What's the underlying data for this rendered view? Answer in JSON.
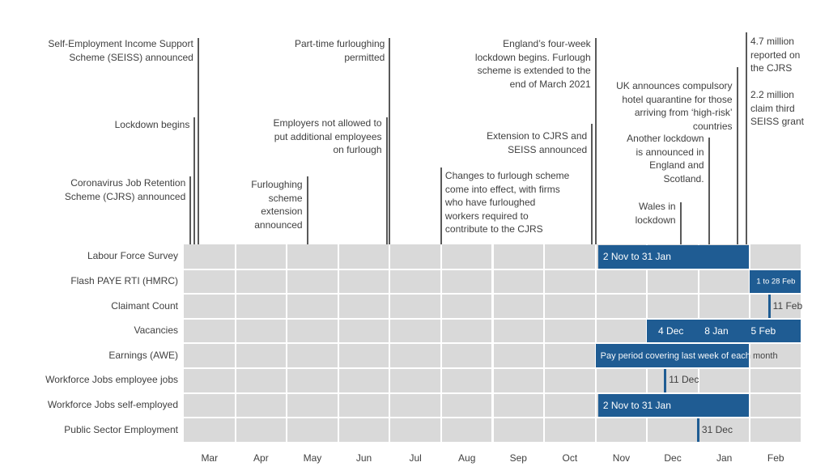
{
  "chart_data": {
    "type": "timeline",
    "title": "",
    "months": [
      "Mar",
      "Apr",
      "May",
      "Jun",
      "Jul",
      "Aug",
      "Sep",
      "Oct",
      "Nov",
      "Dec",
      "Jan",
      "Feb"
    ],
    "rows": [
      "Labour Force Survey",
      "Flash PAYE RTI (HMRC)",
      "Claimant Count",
      "Vacancies",
      "Earnings (AWE)",
      "Workforce Jobs employee jobs",
      "Workforce Jobs self-employed",
      "Public Sector Employment"
    ],
    "bars": [
      {
        "row": 0,
        "start": 8.05,
        "end": 11.0,
        "label": "2 Nov to 31 Jan"
      },
      {
        "row": 1,
        "start": 11.0,
        "end": 12.0,
        "label": "1 to 28 Feb",
        "small": true
      },
      {
        "row": 3,
        "start": 9.0,
        "end": 12.0,
        "labels": [
          {
            "text": "4 Dec",
            "at": 9.5
          },
          {
            "text": "8 Jan",
            "at": 10.4
          },
          {
            "text": "5 Feb",
            "at": 11.3
          }
        ]
      },
      {
        "row": 4,
        "start": 8.0,
        "end": 11.0,
        "label": "Pay period covering last week of each month"
      },
      {
        "row": 6,
        "start": 8.05,
        "end": 11.0,
        "label": "2 Nov to 31 Jan"
      }
    ],
    "markers": [
      {
        "row": 2,
        "at": 11.35,
        "label": "11 Feb"
      },
      {
        "row": 5,
        "at": 9.33,
        "label": "11 Dec"
      },
      {
        "row": 7,
        "at": 9.97,
        "label": "31 Dec"
      }
    ],
    "events": [
      {
        "at": 0.13,
        "align": "right",
        "lines": [
          "Coronavirus Job Retention",
          "Scheme (CJRS) announced"
        ]
      },
      {
        "at": 0.21,
        "align": "right",
        "lines": [
          "Lockdown begins"
        ]
      },
      {
        "at": 0.28,
        "align": "right",
        "lines": [
          "Self-Employment Income Support",
          "Scheme (SEISS) announced"
        ]
      },
      {
        "at": 2.4,
        "align": "right",
        "lines": [
          "Furloughing",
          "scheme",
          "extension",
          "announced"
        ]
      },
      {
        "at": 3.94,
        "align": "right",
        "lines": [
          "Employers not allowed to",
          "put additional employees",
          "on furlough"
        ]
      },
      {
        "at": 4.0,
        "align": "right",
        "lines": [
          "Part-time furloughing",
          "permitted"
        ]
      },
      {
        "at": 5.0,
        "align": "left",
        "lines": [
          "Changes to furlough scheme",
          "come into effect, with firms",
          "who have furloughed",
          "workers required to",
          "contribute to the CJRS"
        ]
      },
      {
        "at": 7.93,
        "align": "right",
        "lines": [
          "Extension to CJRS and",
          "SEISS announced"
        ]
      },
      {
        "at": 8.0,
        "align": "right",
        "lines": [
          "England’s four-week",
          "lockdown begins. Furlough",
          "scheme is extended to the",
          "end of March 2021"
        ]
      },
      {
        "at": 9.65,
        "align": "right",
        "lines": [
          "Wales in",
          "lockdown"
        ]
      },
      {
        "at": 10.2,
        "align": "right",
        "lines": [
          "Another lockdown",
          "is announced in",
          "England and",
          "Scotland."
        ]
      },
      {
        "at": 10.75,
        "align": "right",
        "lines": [
          "UK announces compulsory",
          "hotel quarantine for those",
          "arriving from ‘high-risk’",
          "countries"
        ]
      },
      {
        "at": 10.93,
        "align": "left",
        "lines": [
          "4.7 million",
          "reported on",
          "the CJRS",
          "",
          "2.2 million",
          "claim third",
          "SEISS grant"
        ]
      }
    ],
    "colors": {
      "bar": "#1f5c93",
      "cell": "#d9d9d9",
      "line": "#595959",
      "text": "#404040"
    }
  }
}
